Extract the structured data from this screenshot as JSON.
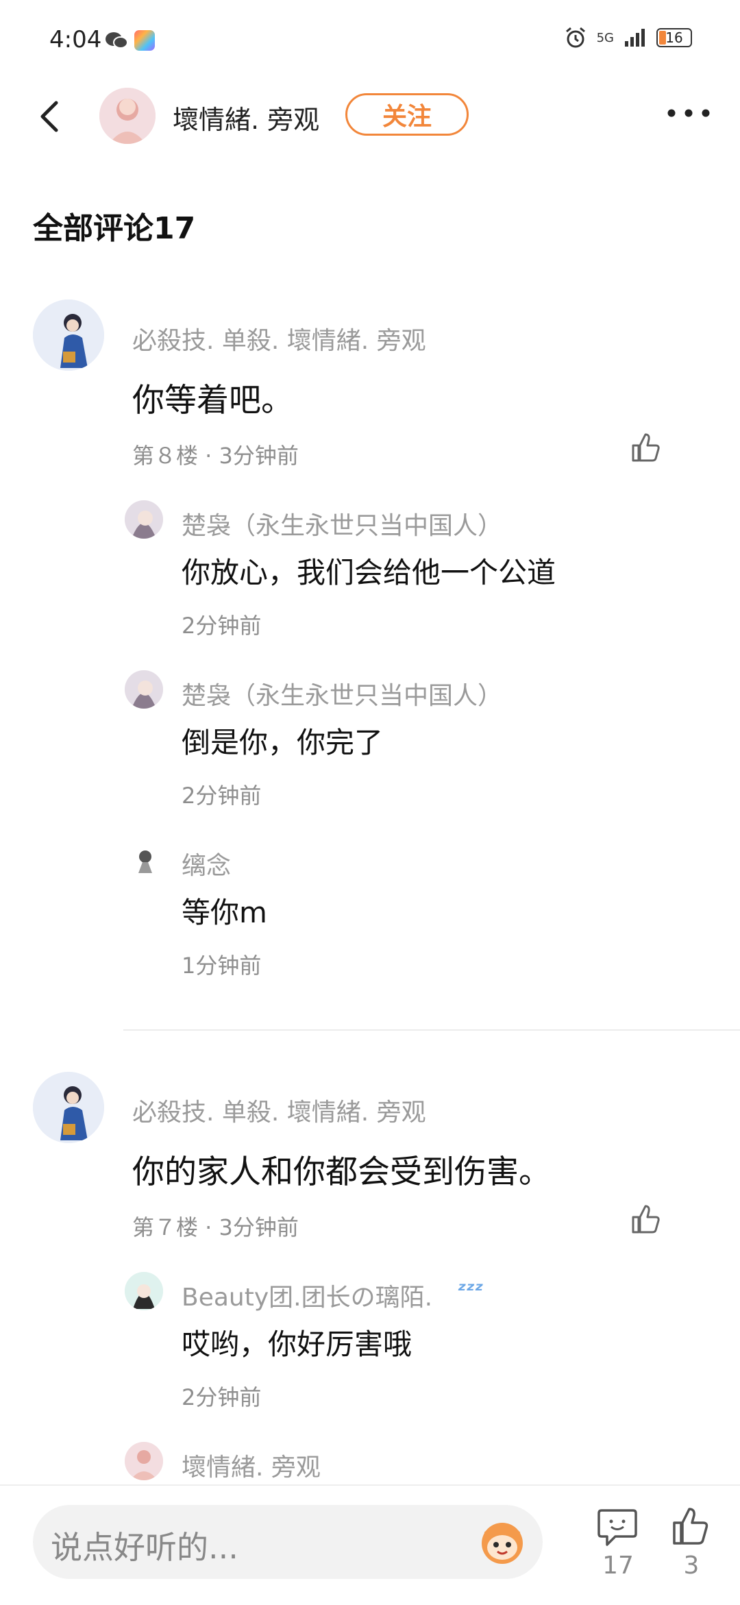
{
  "status": {
    "time": "4:04",
    "network": "5G",
    "battery": "16"
  },
  "header": {
    "author_name": "壞情緒. 旁观",
    "follow_label": "关注"
  },
  "section": {
    "title": "全部评论17"
  },
  "comments": [
    {
      "user": "必殺技. 单殺. 壞情緒. 旁观",
      "text": "你等着吧。",
      "meta": "第８楼 · 3分钟前",
      "replies": [
        {
          "user": "楚袅（永生永世只当中国人）",
          "text": "你放心，我们会给他一个公道",
          "time": "2分钟前"
        },
        {
          "user": "楚袅（永生永世只当中国人）",
          "text": "倒是你，你完了",
          "time": "2分钟前"
        },
        {
          "user": "缡念",
          "text": "等你m",
          "time": "1分钟前"
        }
      ]
    },
    {
      "user": "必殺技. 单殺. 壞情緒. 旁观",
      "text": "你的家人和你都会受到伤害。",
      "meta": "第７楼 · 3分钟前",
      "replies": [
        {
          "user": "Beauty团.团长の璃陌.",
          "text": "哎哟，你好厉害哦",
          "time": "2分钟前"
        },
        {
          "user": "壞情緒. 旁观",
          "text": "",
          "time": ""
        }
      ]
    }
  ],
  "bottom_bar": {
    "input_placeholder": "说点好听的...",
    "comment_count": "17",
    "like_count": "3"
  },
  "colors": {
    "accent": "#f2863a",
    "text": "#111111",
    "secondary": "#9a9a9a"
  }
}
